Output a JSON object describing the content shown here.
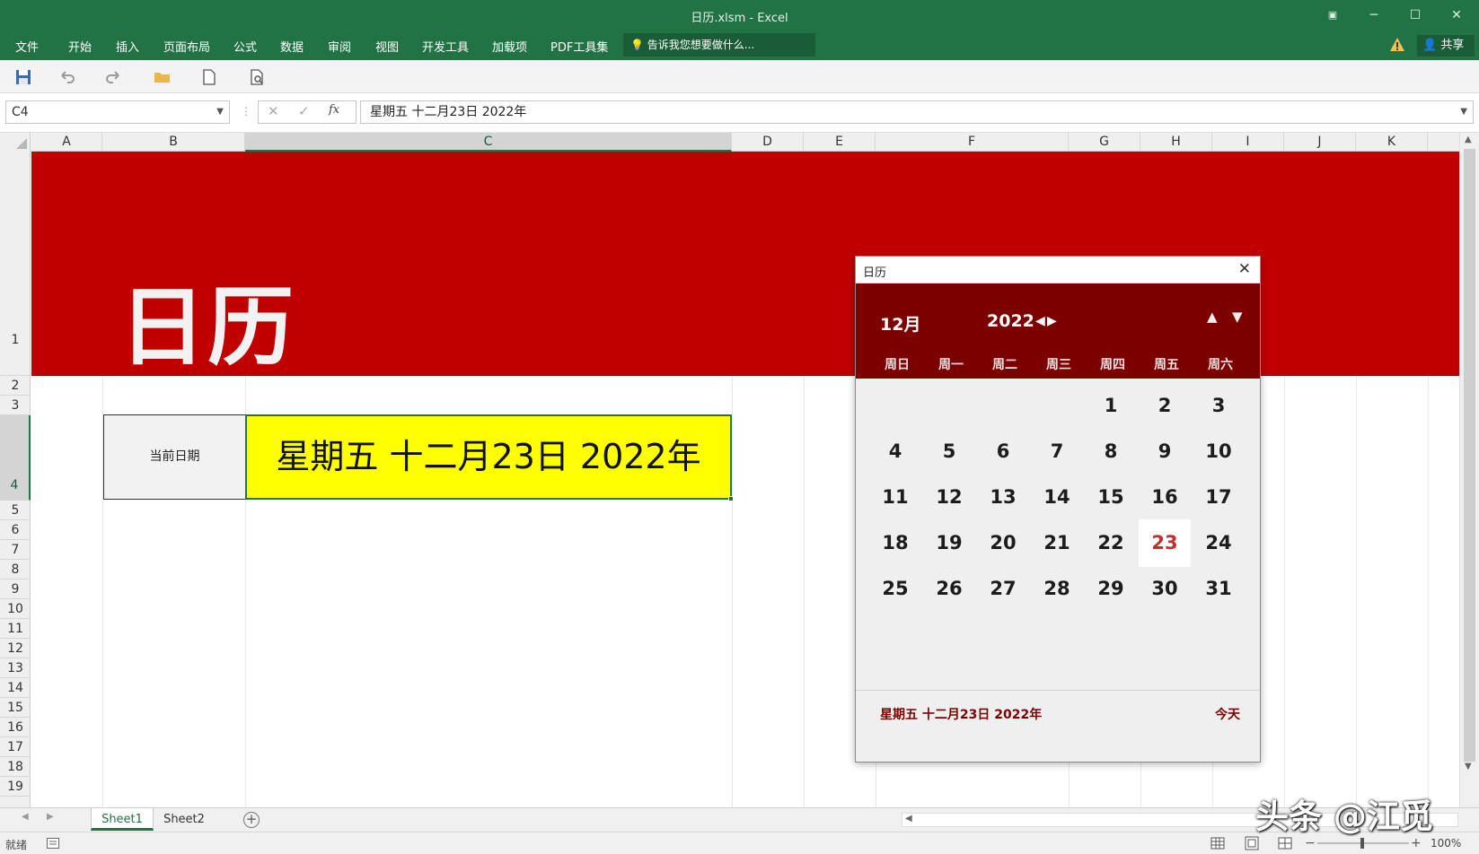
{
  "window": {
    "title": "日历.xlsm - Excel"
  },
  "ribbon": {
    "tabs": [
      "文件",
      "开始",
      "插入",
      "页面布局",
      "公式",
      "数据",
      "审阅",
      "视图",
      "开发工具",
      "加载项",
      "PDF工具集"
    ],
    "tell_me": "告诉我您想要做什么...",
    "share": "共享"
  },
  "formula_bar": {
    "name_box": "C4",
    "cancel_icon": "✕",
    "enter_icon": "✓",
    "fx_label": "fx",
    "content": "星期五  十二月23日  2022年"
  },
  "grid": {
    "columns": [
      "A",
      "B",
      "C",
      "D",
      "E",
      "F",
      "G",
      "H",
      "I",
      "J",
      "K"
    ],
    "selected_column": "C",
    "rows": [
      "1",
      "2",
      "3",
      "4",
      "5",
      "6",
      "7",
      "8",
      "9",
      "10",
      "11",
      "12",
      "13",
      "14",
      "15",
      "16",
      "17",
      "18",
      "19"
    ],
    "selected_row": "4",
    "banner_title": "日历",
    "label_cell": "当前日期",
    "value_cell": "星期五  十二月23日  2022年",
    "colors": {
      "banner": "#c00000",
      "value_fill": "#ffff00",
      "accent": "#217346"
    }
  },
  "sheets": {
    "tabs": [
      "Sheet1",
      "Sheet2"
    ],
    "active": "Sheet1"
  },
  "status": {
    "ready": "就绪",
    "zoom": "100%"
  },
  "calendar": {
    "window_title": "日历",
    "month": "12月",
    "year": "2022",
    "weekdays": [
      "周日",
      "周一",
      "周二",
      "周三",
      "周四",
      "周五",
      "周六"
    ],
    "first_weekday_index": 4,
    "days_in_month": 31,
    "today": 23,
    "footer_date": "星期五  十二月23日  2022年",
    "today_button": "今天",
    "colors": {
      "header": "#7d0000",
      "today_text": "#c0302f"
    }
  },
  "watermark": "头条 @江觅"
}
